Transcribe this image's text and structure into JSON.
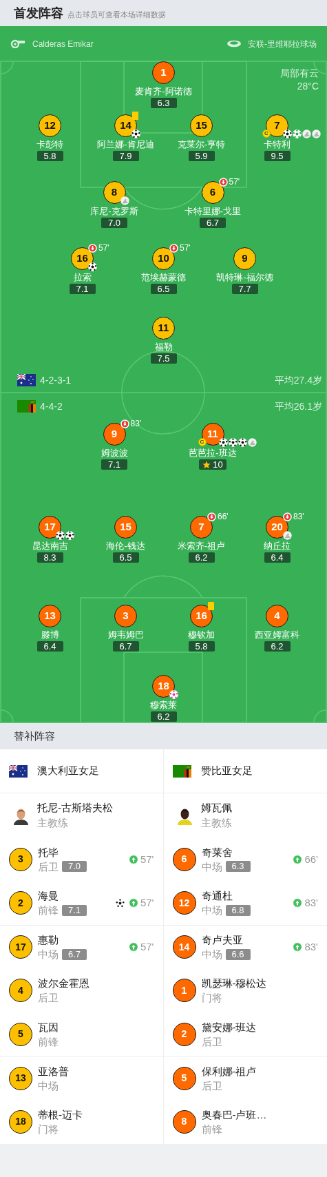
{
  "header": {
    "title": "首发阵容",
    "subtitle": "点击球员可查看本场详细数据"
  },
  "match_info": {
    "referee": "Calderas Emikar",
    "stadium": "安联-里维耶拉球场",
    "weather": "局部有云",
    "temperature": "28°C"
  },
  "teams": [
    {
      "flag": {
        "kind": "australia"
      },
      "formation": "4-2-3-1",
      "average_age": "平均27.4岁",
      "lines": [
        {
          "players": [
            {
              "number": "1",
              "name": "麦肯齐-阿诺德",
              "rating": "6.3",
              "color": "#ff6a00",
              "mvp": false,
              "yellow_card": false
            }
          ]
        },
        {
          "players": [
            {
              "number": "12",
              "name": "卡彭特",
              "rating": "5.8",
              "color": "#fdc000",
              "mvp": false,
              "yellow_card": false
            },
            {
              "number": "14",
              "name": "阿兰娜-肯尼迪",
              "rating": "7.9",
              "color": "#fdc000",
              "mvp": false,
              "yellow_card": true,
              "icons": [
                {
                  "kind": "goal"
                }
              ]
            },
            {
              "number": "15",
              "name": "克莱尔-亨特",
              "rating": "5.9",
              "color": "#fdc000",
              "mvp": false,
              "yellow_card": false
            },
            {
              "number": "7",
              "name": "卡特利",
              "rating": "9.5",
              "color": "#fdc000",
              "mvp": false,
              "yellow_card": false,
              "captain_badge": "C",
              "icons": [
                {
                  "kind": "goal"
                },
                {
                  "kind": "penalty_goal"
                },
                {
                  "kind": "assist"
                },
                {
                  "kind": "assist"
                }
              ]
            }
          ]
        },
        {
          "players": [
            {
              "number": "8",
              "name": "库尼-克罗斯",
              "rating": "7.0",
              "color": "#fdc000",
              "mvp": false,
              "yellow_card": false,
              "icons": [
                {
                  "kind": "assist"
                }
              ]
            },
            {
              "number": "6",
              "name": "卡特里娜-戈里",
              "rating": "6.7",
              "color": "#fdc000",
              "mvp": false,
              "yellow_card": false,
              "sub_off": "57'"
            }
          ]
        },
        {
          "players": [
            {
              "number": "16",
              "name": "拉索",
              "rating": "7.1",
              "color": "#fdc000",
              "mvp": false,
              "yellow_card": false,
              "sub_off": "57'",
              "icons": [
                {
                  "kind": "goal"
                }
              ]
            },
            {
              "number": "10",
              "name": "范埃赫蒙德",
              "rating": "6.5",
              "color": "#fdc000",
              "mvp": false,
              "yellow_card": false,
              "sub_off": "57'"
            },
            {
              "number": "9",
              "name": "凯特琳-福尔德",
              "rating": "7.7",
              "color": "#fdc000",
              "mvp": false,
              "yellow_card": false
            }
          ]
        },
        {
          "players": [
            {
              "number": "11",
              "name": "福勒",
              "rating": "7.5",
              "color": "#fdc000",
              "mvp": false,
              "yellow_card": false
            }
          ]
        }
      ]
    },
    {
      "flag": {
        "kind": "zambia"
      },
      "formation": "4-4-2",
      "average_age": "平均26.1岁",
      "lines": [
        {
          "players": [
            {
              "number": "9",
              "name": "姆波波",
              "rating": "7.1",
              "color": "#ff6a00",
              "mvp": false,
              "yellow_card": false,
              "sub_off": "83'"
            },
            {
              "number": "11",
              "name": "芭芭拉-班达",
              "rating": "10",
              "color": "#ff6a00",
              "mvp": true,
              "yellow_card": false,
              "captain_badge": "C",
              "icons": [
                {
                  "kind": "goal"
                },
                {
                  "kind": "goal"
                },
                {
                  "kind": "goal"
                },
                {
                  "kind": "assist"
                }
              ]
            }
          ]
        },
        {
          "players": [
            {
              "number": "17",
              "name": "昆达南吉",
              "rating": "8.3",
              "color": "#ff6a00",
              "mvp": false,
              "yellow_card": false,
              "icons": [
                {
                  "kind": "goal"
                },
                {
                  "kind": "goal"
                }
              ]
            },
            {
              "number": "15",
              "name": "海伦-钱达",
              "rating": "6.5",
              "color": "#ff6a00",
              "mvp": false,
              "yellow_card": false
            },
            {
              "number": "7",
              "name": "米索齐-祖卢",
              "rating": "6.2",
              "color": "#ff6a00",
              "mvp": false,
              "yellow_card": false,
              "sub_off": "66'"
            },
            {
              "number": "20",
              "name": "纳丘拉",
              "rating": "6.4",
              "color": "#ff6a00",
              "mvp": false,
              "yellow_card": false,
              "sub_off": "83'",
              "icons": [
                {
                  "kind": "assist"
                }
              ]
            }
          ]
        },
        {
          "players": [
            {
              "number": "13",
              "name": "滕博",
              "rating": "6.4",
              "color": "#ff6a00",
              "mvp": false,
              "yellow_card": false
            },
            {
              "number": "3",
              "name": "姆韦姆巴",
              "rating": "6.7",
              "color": "#ff6a00",
              "mvp": false,
              "yellow_card": false
            },
            {
              "number": "16",
              "name": "穆钦加",
              "rating": "5.8",
              "color": "#ff6a00",
              "mvp": false,
              "yellow_card": true
            },
            {
              "number": "4",
              "name": "西亚姆富科",
              "rating": "6.2",
              "color": "#ff6a00",
              "mvp": false,
              "yellow_card": false
            }
          ]
        },
        {
          "players": [
            {
              "number": "18",
              "name": "穆索莱",
              "rating": "6.2",
              "color": "#ff6a00",
              "mvp": false,
              "yellow_card": false,
              "icons": [
                {
                  "kind": "own_goal"
                }
              ]
            }
          ]
        }
      ]
    }
  ],
  "bench": {
    "title": "替补阵容",
    "teams": [
      {
        "flag": {
          "kind": "australia"
        },
        "name": "澳大利亚女足",
        "color": "#fdc000",
        "coach": {
          "name": "托尼-古斯塔夫松",
          "role": "主教练"
        },
        "players": [
          {
            "number": "3",
            "name": "托毕",
            "position": "后卫",
            "rating": "7.0",
            "sub_on": "57'",
            "goal": false,
            "divider_above": false
          },
          {
            "number": "2",
            "name": "海曼",
            "position": "前锋",
            "rating": "7.1",
            "sub_on": "57'",
            "goal": true,
            "divider_above": false
          },
          {
            "number": "17",
            "name": "惠勒",
            "position": "中场",
            "rating": "6.7",
            "sub_on": "57'",
            "goal": false,
            "divider_above": true
          },
          {
            "number": "4",
            "name": "波尔金霍恩",
            "position": "后卫",
            "goal": false,
            "divider_above": false
          },
          {
            "number": "5",
            "name": "瓦因",
            "position": "前锋",
            "goal": false,
            "divider_above": false
          },
          {
            "number": "13",
            "name": "亚洛普",
            "position": "中场",
            "goal": false,
            "divider_above": true
          },
          {
            "number": "18",
            "name": "蒂根-迈卡",
            "position": "门将",
            "goal": false,
            "divider_above": false
          }
        ]
      },
      {
        "flag": {
          "kind": "zambia"
        },
        "name": "赞比亚女足",
        "color": "#ff6a00",
        "coach": {
          "name": "姆瓦佩",
          "role": "主教练"
        },
        "players": [
          {
            "number": "6",
            "name": "奇莱舍",
            "position": "中场",
            "rating": "6.3",
            "sub_on": "66'",
            "goal": false,
            "divider_above": false
          },
          {
            "number": "12",
            "name": "奇通杜",
            "position": "中场",
            "rating": "6.8",
            "sub_on": "83'",
            "goal": false,
            "divider_above": false
          },
          {
            "number": "14",
            "name": "奇卢夫亚",
            "position": "中场",
            "rating": "6.6",
            "sub_on": "83'",
            "goal": false,
            "divider_above": true
          },
          {
            "number": "1",
            "name": "凯瑟琳-穆松达",
            "position": "门将",
            "goal": false,
            "divider_above": false
          },
          {
            "number": "2",
            "name": "黛安娜-班达",
            "position": "后卫",
            "goal": false,
            "divider_above": false
          },
          {
            "number": "5",
            "name": "保利娜-祖卢",
            "position": "后卫",
            "goal": false,
            "divider_above": true
          },
          {
            "number": "8",
            "name": "奥春巴-卢班…",
            "position": "前锋",
            "goal": false,
            "divider_above": false
          }
        ]
      }
    ]
  }
}
